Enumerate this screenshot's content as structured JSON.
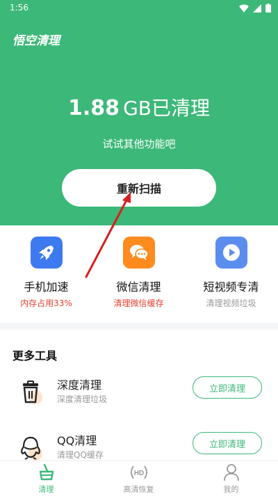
{
  "status_bar": {
    "time": "1:56"
  },
  "header": {
    "app_title": "悟空清理"
  },
  "result": {
    "size": "1.88",
    "unit": "GB已清理",
    "subtitle": "试试其他功能吧",
    "rescan_label": "重新扫描"
  },
  "features": [
    {
      "title": "手机加速",
      "subtitle": "内存占用33%",
      "subtitle_color": "#e8402f",
      "icon": "rocket-icon",
      "icon_color": "#3d7af0"
    },
    {
      "title": "微信清理",
      "subtitle": "清理微信缓存",
      "subtitle_color": "#e8402f",
      "icon": "wechat-icon",
      "icon_color": "#ff8a1e"
    },
    {
      "title": "短视频专清",
      "subtitle": "清理视频垃圾",
      "subtitle_color": "#999999",
      "icon": "video-play-icon",
      "icon_color": "#5b8def"
    }
  ],
  "more_tools": {
    "heading": "更多工具",
    "items": [
      {
        "title": "深度清理",
        "subtitle": "深度清理垃圾",
        "button_label": "立即清理",
        "icon": "trash-bin-icon"
      },
      {
        "title": "QQ清理",
        "subtitle": "清理QQ缓存",
        "button_label": "立即清理",
        "icon": "qq-penguin-icon"
      }
    ]
  },
  "bottom_nav": [
    {
      "label": "清理",
      "icon": "broom-basket-icon",
      "active": true
    },
    {
      "label": "高清恢复",
      "icon": "hd-icon",
      "active": false
    },
    {
      "label": "我的",
      "icon": "user-icon",
      "active": false
    }
  ],
  "colors": {
    "brand_green": "#3cb878",
    "annotation_red": "#d81e1e"
  }
}
